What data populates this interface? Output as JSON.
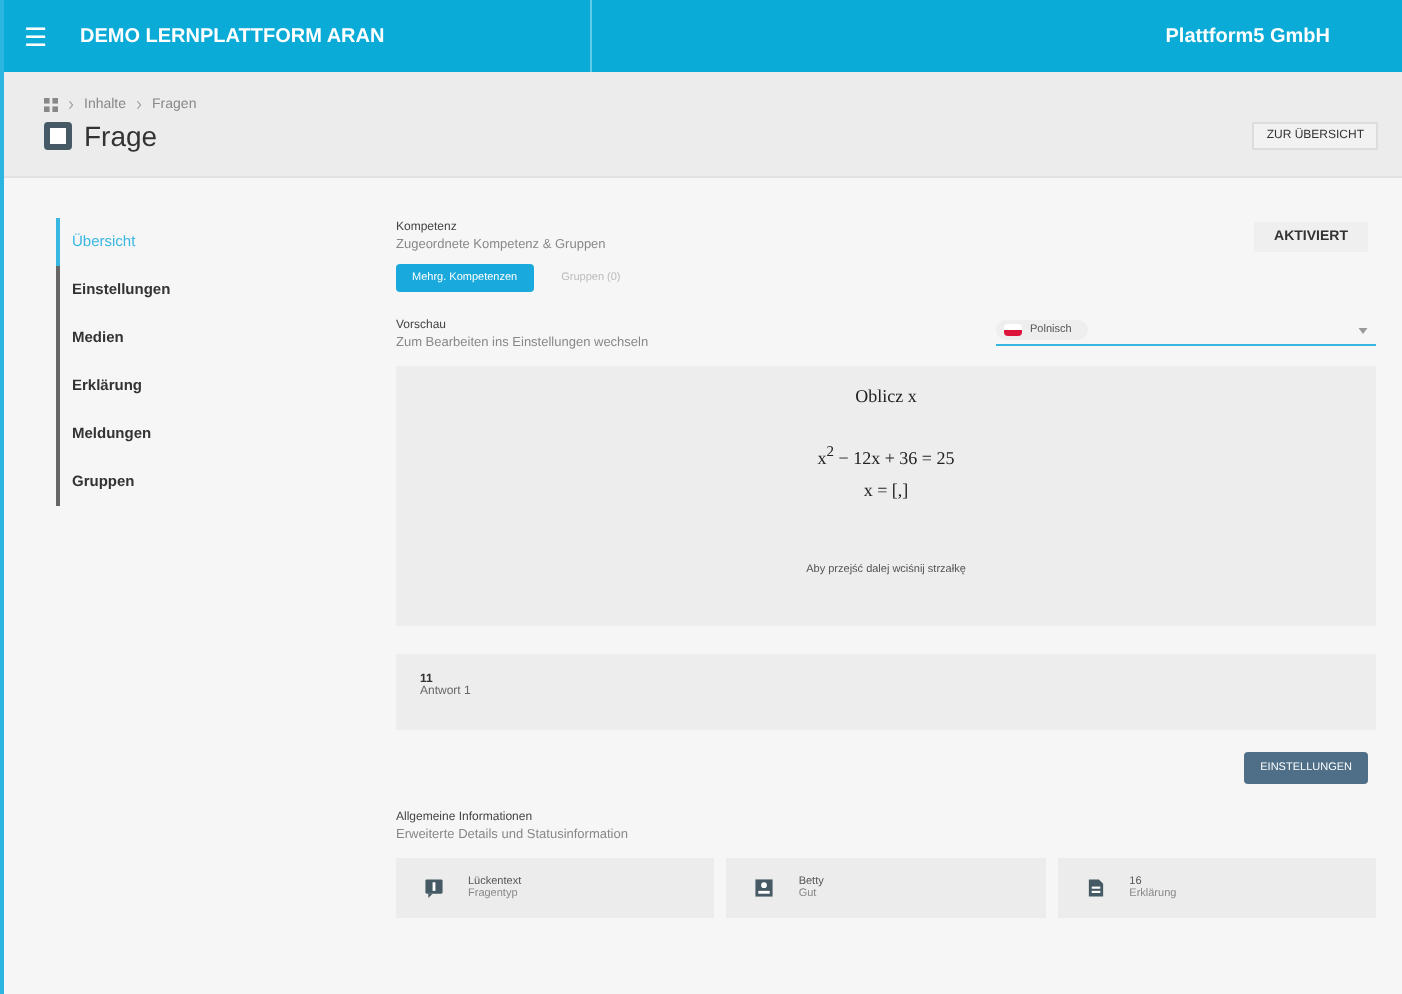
{
  "app_bar": {
    "menu_icon": "☰",
    "title": "DEMO LERNPLATTFORM ARAN",
    "organization": "Plattform5 GmbH"
  },
  "breadcrumb": [
    "Inhalte",
    "Fragen"
  ],
  "page_title": "Frage",
  "overview_button": "ZUR ÜBERSICHT",
  "sidebar": {
    "items": [
      {
        "label": "Übersicht",
        "selected": true
      },
      {
        "label": "Einstellungen",
        "selected": false
      },
      {
        "label": "Medien",
        "selected": false
      },
      {
        "label": "Erklärung",
        "selected": false
      },
      {
        "label": "Meldungen",
        "selected": false
      },
      {
        "label": "Gruppen",
        "selected": false
      }
    ]
  },
  "competence": {
    "label": "Kompetenz",
    "description": "Zugeordnete Kompetenz & Gruppen",
    "tabs": [
      {
        "label": "Mehrg. Kompetenzen",
        "selected": true
      },
      {
        "label": "Gruppen (0)",
        "selected": false
      }
    ],
    "status": "AKTIVIERT"
  },
  "preview": {
    "label": "Vorschau",
    "description": "Zum Bearbeiten ins Einstellungen wechseln",
    "language": "Polnisch",
    "question": {
      "title": "Oblicz x",
      "equation": "x$^{2}$ − 12x + 36 = 25",
      "answer_line": "x = [,]",
      "hint": "Aby przejść dalej wciśnij strzałkę"
    },
    "answer": {
      "number": "11",
      "label": "Antwort 1"
    }
  },
  "settings_button": "EINSTELLUNGEN",
  "general": {
    "label": "Allgemeine Informationen",
    "description": "Erweiterte Details und Statusinformation",
    "cards": [
      {
        "kind": "type",
        "value": "Lückentext",
        "caption": "Fragentyp"
      },
      {
        "kind": "author",
        "value": "Betty",
        "caption": "Gut"
      },
      {
        "kind": "explanation",
        "value": "16",
        "caption": "Erklärung"
      }
    ]
  }
}
